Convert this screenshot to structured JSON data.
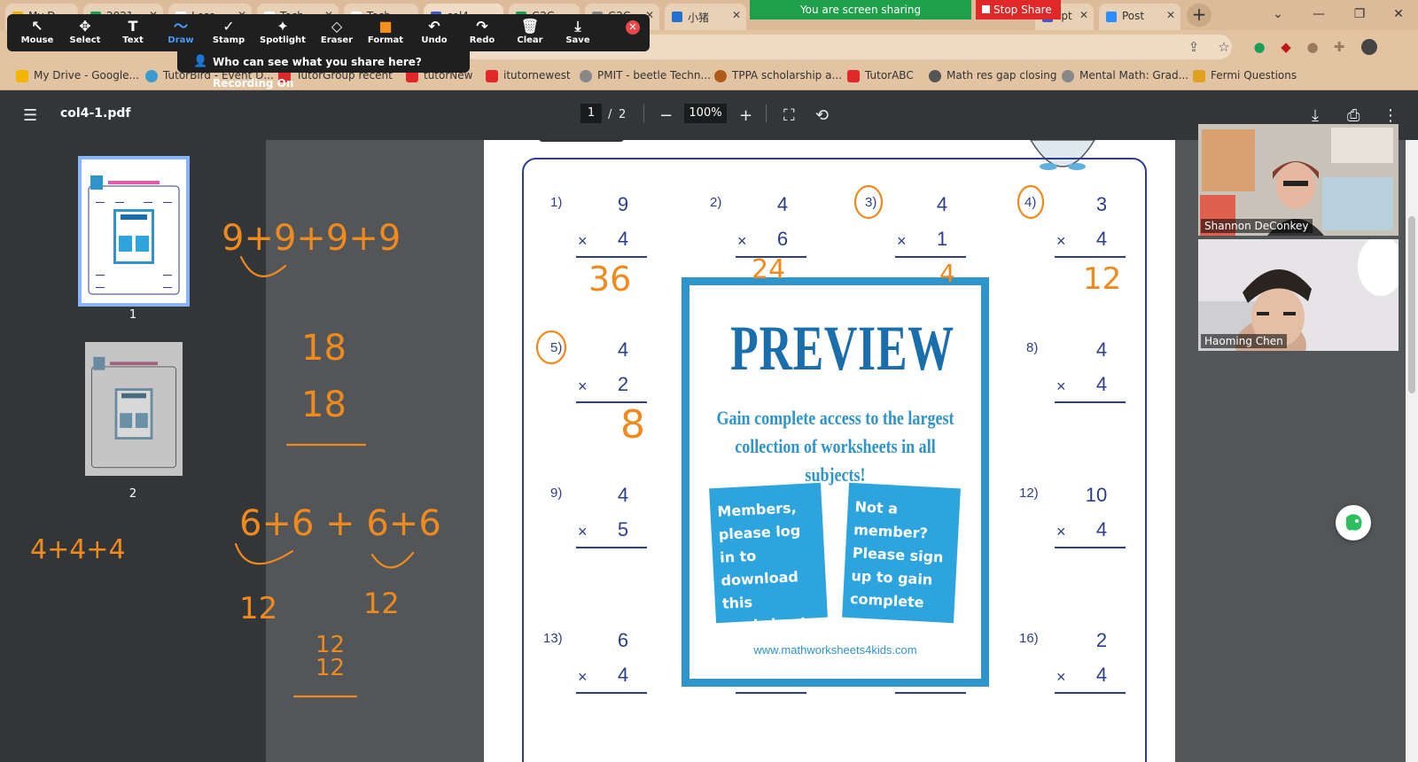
{
  "browser": {
    "tabs": [
      {
        "label": "My D",
        "color": "#e8b400"
      },
      {
        "label": "2021",
        "color": "#18a05a"
      },
      {
        "label": "Less",
        "color": "#ffffff"
      },
      {
        "label": "Tech",
        "color": "#ffffff"
      },
      {
        "label": "Tech",
        "color": "#ffffff"
      },
      {
        "label": "col4",
        "color": "#3a5ad0"
      },
      {
        "label": "G2G",
        "color": "#18a05a"
      },
      {
        "label": "G2G",
        "color": "#888888"
      },
      {
        "label": "小猪",
        "color": "#2470d0"
      },
      {
        "label": "ipt",
        "color": "#3a5ad0"
      },
      {
        "label": "Post",
        "color": "#2d8cff"
      }
    ],
    "new_tab": "+",
    "bookmarks": [
      {
        "label": "My Drive - Google...",
        "color": "#f4b400"
      },
      {
        "label": "TutorBird - Event D...",
        "color": "#3a9bd0"
      },
      {
        "label": "TutorGroup recent",
        "color": "#e02828"
      },
      {
        "label": "tutorNew",
        "color": "#e02828"
      },
      {
        "label": "itutornewest",
        "color": "#e02828"
      },
      {
        "label": "PMIT - beetle Techn...",
        "color": "#888888"
      },
      {
        "label": "TPPA scholarship a...",
        "color": "#b05a1a"
      },
      {
        "label": "TutorABC",
        "color": "#e02828"
      },
      {
        "label": "Math res gap closing",
        "color": "#555555"
      },
      {
        "label": "Mental Math: Grad...",
        "color": "#888888"
      },
      {
        "label": "Fermi Questions",
        "color": "#e0a020"
      }
    ]
  },
  "zoom": {
    "sharing_text": "You are screen sharing",
    "stop_share": "Stop Share",
    "recording_text": "Who can see what you share here? Recording On",
    "tools": [
      {
        "label": "Mouse",
        "icon": "↖"
      },
      {
        "label": "Select",
        "icon": "✥"
      },
      {
        "label": "Text",
        "icon": "T"
      },
      {
        "label": "Draw",
        "icon": "〜"
      },
      {
        "label": "Stamp",
        "icon": "✓"
      },
      {
        "label": "Spotlight",
        "icon": "✦"
      },
      {
        "label": "Eraser",
        "icon": "◇"
      },
      {
        "label": "Format",
        "icon": "■"
      },
      {
        "label": "Undo",
        "icon": "↶"
      },
      {
        "label": "Redo",
        "icon": "↷"
      },
      {
        "label": "Clear",
        "icon": "🗑"
      },
      {
        "label": "Save",
        "icon": "⤓"
      }
    ],
    "close_icon": "✕",
    "participants": [
      {
        "name": "Shannon DeConkey"
      },
      {
        "name": "Haoming Chen"
      }
    ]
  },
  "pdf": {
    "filename": "col4-1.pdf",
    "current_page": "1",
    "page_sep": "/",
    "total_pages": "2",
    "zoom": "100%",
    "thumb_labels": [
      "1",
      "2"
    ]
  },
  "worksheet": {
    "problems": [
      {
        "num": "1)",
        "top": "9",
        "bottom": "4"
      },
      {
        "num": "2)",
        "top": "4",
        "bottom": "6"
      },
      {
        "num": "3)",
        "top": "4",
        "bottom": "1"
      },
      {
        "num": "4)",
        "top": "3",
        "bottom": "4"
      },
      {
        "num": "5)",
        "top": "4",
        "bottom": "2"
      },
      {
        "num": "8)",
        "top": "4",
        "bottom": "4"
      },
      {
        "num": "9)",
        "top": "4",
        "bottom": "5"
      },
      {
        "num": "12)",
        "top": "10",
        "bottom": "4"
      },
      {
        "num": "13)",
        "top": "6",
        "bottom": "4"
      },
      {
        "num": "16)",
        "top": "2",
        "bottom": "4"
      }
    ],
    "times_symbol": "×",
    "preview": {
      "title": "PREVIEW",
      "line1": "Gain complete access to the largest",
      "line2": "collection of worksheets in all subjects!",
      "members_card": "Members, please log in to download this worksheet.",
      "nonmember_card": "Not a member? Please sign up to gain complete access.",
      "url": "www.mathworksheets4kids.com"
    }
  },
  "annotations": {
    "written": [
      "9+9+9+9",
      "18",
      "18",
      "6+6 + 6+6",
      "12",
      "12",
      "12",
      "12",
      "4+4+4",
      "36",
      "24",
      "4",
      "12",
      "8",
      "3)",
      "4)",
      "5)"
    ],
    "ink_color": "#f08a1c"
  }
}
